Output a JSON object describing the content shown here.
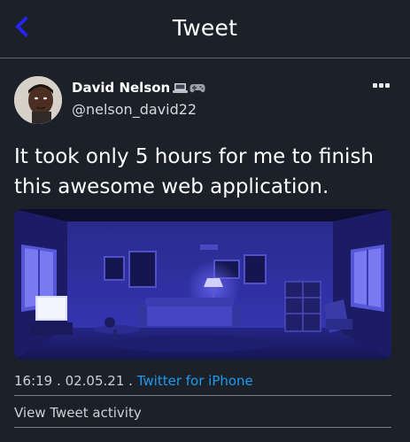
{
  "header": {
    "title": "Tweet",
    "back_icon": "chevron-left-icon",
    "accent_color": "#1d1df0"
  },
  "tweet": {
    "author": {
      "display_name": "David Nelson",
      "badges": [
        "laptop-emoji",
        "game-controller-emoji"
      ],
      "handle": "@nelson_david22"
    },
    "more_icon": "more-dots-icon",
    "text": "It took only 5 hours for me to finish this awesome web application.",
    "media_description_icon": "image",
    "time": "16:19",
    "separator1": ".",
    "date": "02.05.21",
    "separator2": ".",
    "source": "Twitter for iPhone",
    "source_color": "#1d9bf0",
    "activity_label": "View Tweet activity"
  }
}
